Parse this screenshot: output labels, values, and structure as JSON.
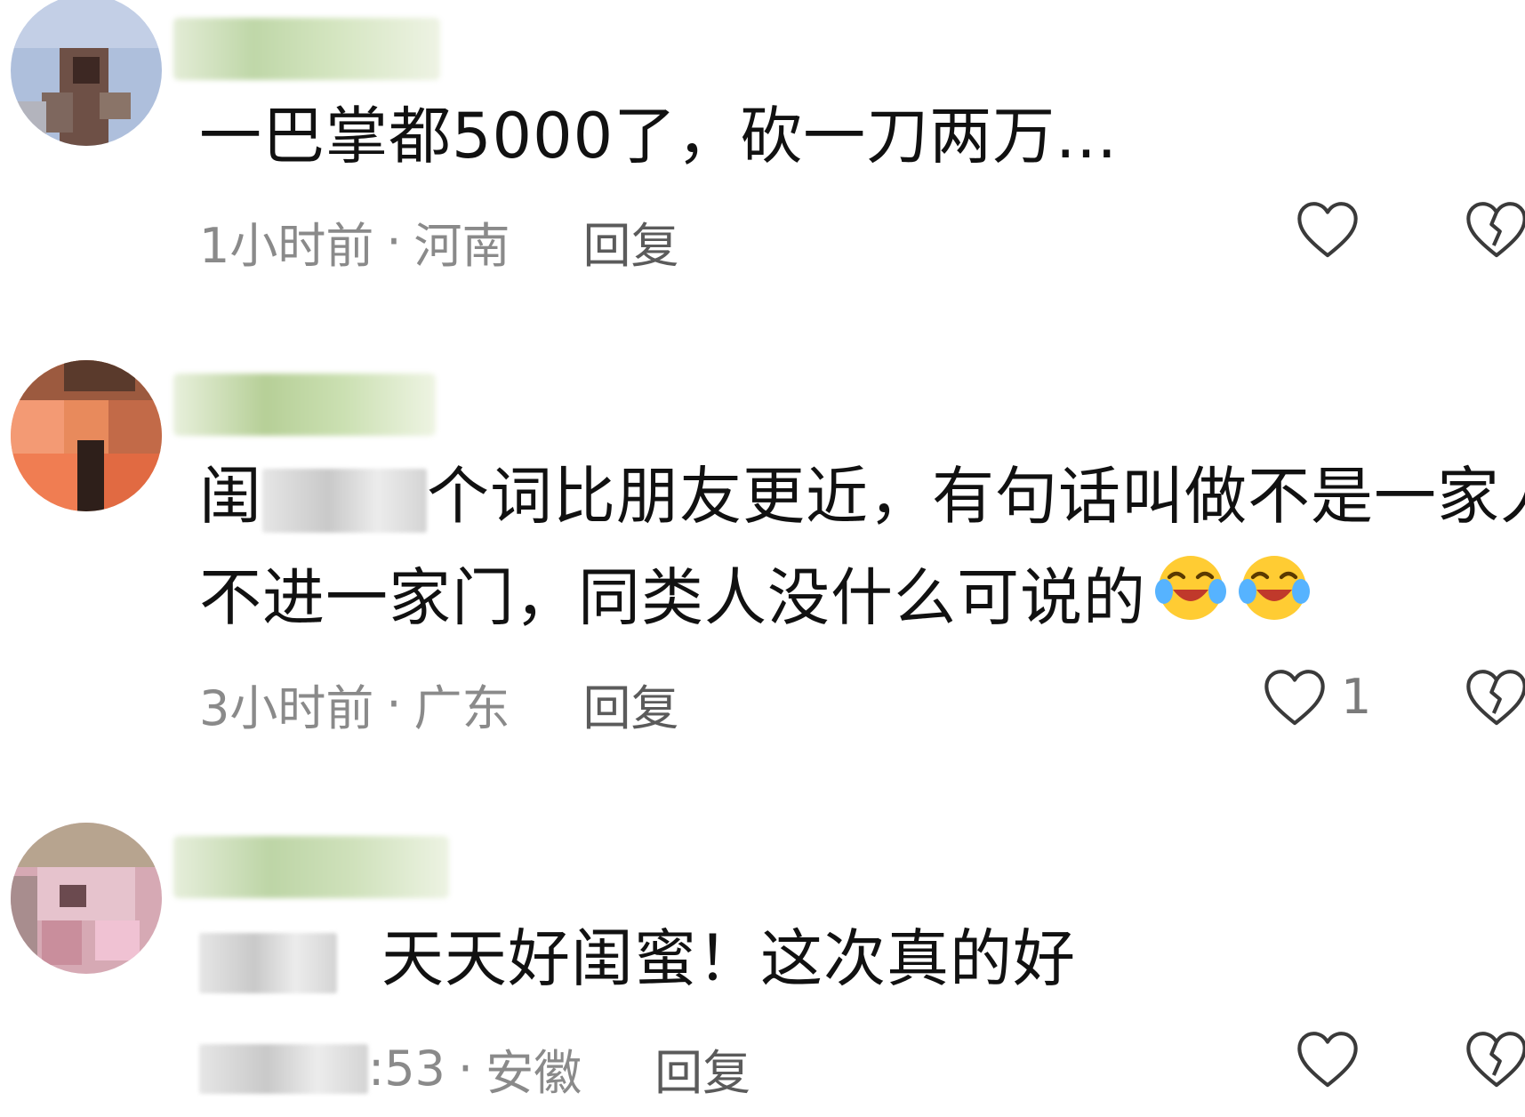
{
  "comments": [
    {
      "text": "一巴掌都5000了，砍一刀两万...",
      "time": "1小时前",
      "separator": "·",
      "region": "河南",
      "reply_label": "回复",
      "like_count": ""
    },
    {
      "text_prefix": "闺",
      "text_rest": "个词比朋友更近，有句话叫做不是一家人",
      "text_line2": "不进一家门，同类人没什么可说的",
      "emoji_names": [
        "crying-laughing-emoji",
        "crying-laughing-emoji"
      ],
      "time": "3小时前",
      "separator": "·",
      "region": "广东",
      "reply_label": "回复",
      "like_count": "1"
    },
    {
      "text_rest": "天天好闺蜜！这次真的好",
      "time_visible": ":53",
      "separator": "·",
      "region": "安徽",
      "reply_label": "回复",
      "like_count": ""
    }
  ],
  "icons": {
    "like": "heart-outline-icon",
    "dislike": "broken-heart-icon"
  },
  "colors": {
    "text": "#111111",
    "meta": "#8a8a8a",
    "reply": "#5b5b5b",
    "icon_stroke": "#3a3a3a"
  }
}
